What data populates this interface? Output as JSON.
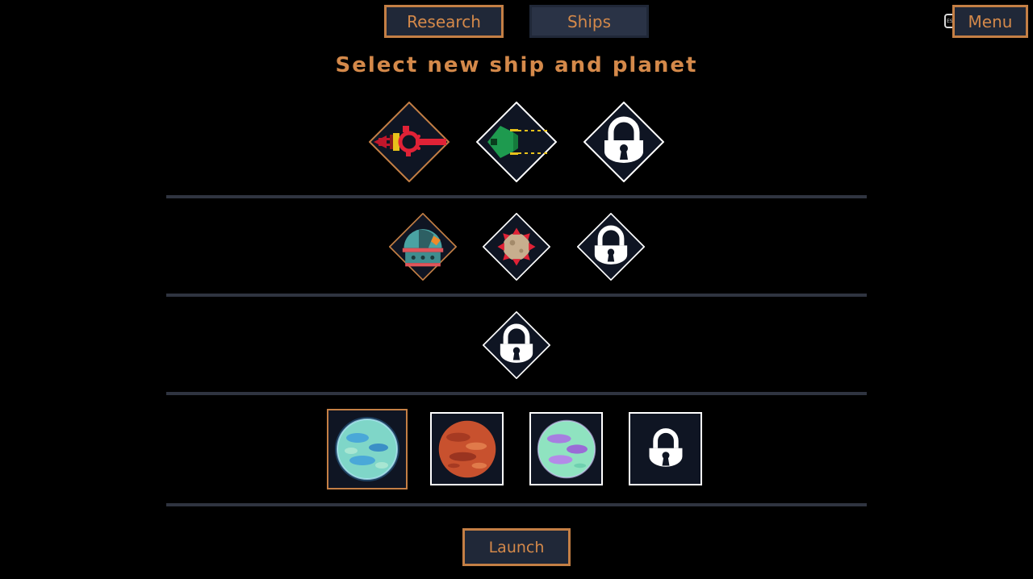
{
  "tabs": [
    {
      "label": "Research",
      "active": false
    },
    {
      "label": "Ships",
      "active": true
    }
  ],
  "menu": {
    "label": "Menu",
    "key_hint": "ESC"
  },
  "title": "Select new ship and planet",
  "ship_rows": [
    [
      {
        "icon": "red-ship-icon",
        "selected": true,
        "locked": false
      },
      {
        "icon": "green-ship-icon",
        "selected": false,
        "locked": false
      },
      {
        "icon": "lock-icon",
        "selected": false,
        "locked": true
      }
    ],
    [
      {
        "icon": "dome-module-icon",
        "selected": true,
        "locked": false
      },
      {
        "icon": "spiked-mine-icon",
        "selected": false,
        "locked": false
      },
      {
        "icon": "lock-icon",
        "selected": false,
        "locked": true
      }
    ],
    [
      {
        "icon": "lock-icon",
        "selected": false,
        "locked": true
      }
    ]
  ],
  "planets": [
    {
      "icon": "blue-green-planet-icon",
      "selected": true,
      "locked": false
    },
    {
      "icon": "red-planet-icon",
      "selected": false,
      "locked": false
    },
    {
      "icon": "purple-green-planet-icon",
      "selected": false,
      "locked": false
    },
    {
      "icon": "lock-icon",
      "selected": false,
      "locked": true
    }
  ],
  "launch": {
    "label": "Launch"
  },
  "colors": {
    "accent": "#c47f45",
    "text": "#d4894a",
    "panel": "#0f1523",
    "button_bg": "#202838",
    "divider": "#2f3440"
  }
}
